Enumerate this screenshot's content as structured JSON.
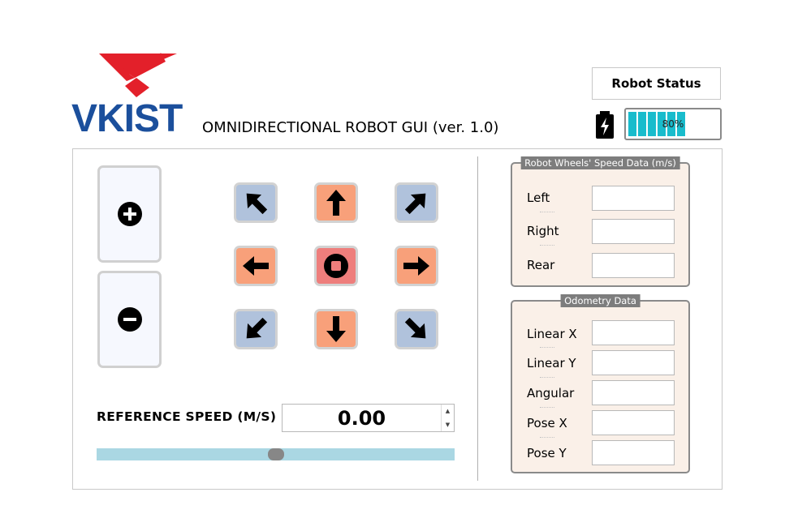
{
  "header": {
    "logo_text": "VKIST",
    "app_title": "OMNIDIRECTIONAL ROBOT GUI (ver. 1.0)",
    "status_button_label": "Robot Status",
    "battery": {
      "level_percent": 80,
      "label": "80%",
      "segments": 8,
      "color": "#19bccc"
    }
  },
  "zoom_controls": {
    "increase_icon": "plus-circle-icon",
    "decrease_icon": "minus-circle-icon"
  },
  "direction_pad": {
    "buttons": [
      {
        "name": "up-left",
        "icon": "arrow-up-left-icon"
      },
      {
        "name": "up",
        "icon": "arrow-up-icon"
      },
      {
        "name": "up-right",
        "icon": "arrow-up-right-icon"
      },
      {
        "name": "left",
        "icon": "arrow-left-icon"
      },
      {
        "name": "stop",
        "icon": "stop-icon"
      },
      {
        "name": "right",
        "icon": "arrow-right-icon"
      },
      {
        "name": "down-left",
        "icon": "arrow-down-left-icon"
      },
      {
        "name": "down",
        "icon": "arrow-down-icon"
      },
      {
        "name": "down-right",
        "icon": "arrow-down-right-icon"
      }
    ],
    "colors": {
      "diagonal": "#b0c2dc",
      "orthogonal": "#f8a07a",
      "stop": "#ee7e7c"
    }
  },
  "speed_control": {
    "label": "REFERENCE SPEED (M/S)",
    "value": "0.00",
    "slider_position": 0.5
  },
  "wheels_group": {
    "title": "Robot Wheels' Speed Data (m/s)",
    "fields": [
      {
        "label": "Left",
        "value": ""
      },
      {
        "label": "Right",
        "value": ""
      },
      {
        "label": "Rear",
        "value": ""
      }
    ]
  },
  "odometry_group": {
    "title": "Odometry Data",
    "fields": [
      {
        "label": "Linear X",
        "value": ""
      },
      {
        "label": "Linear Y",
        "value": ""
      },
      {
        "label": "Angular",
        "value": ""
      },
      {
        "label": "Pose X",
        "value": ""
      },
      {
        "label": "Pose Y",
        "value": ""
      }
    ]
  }
}
